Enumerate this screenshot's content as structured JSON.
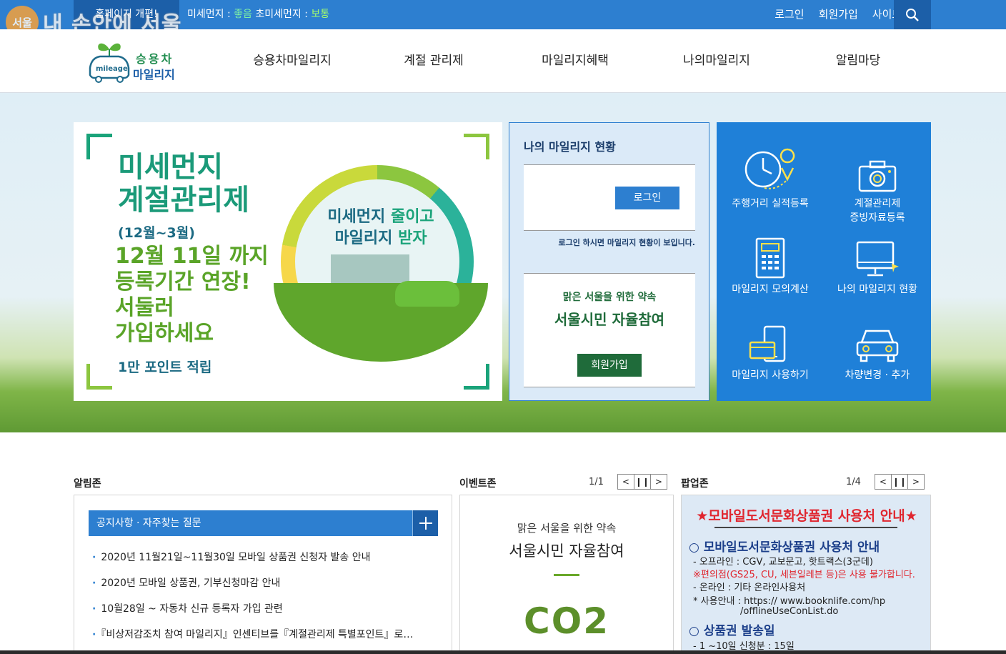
{
  "topbar": {
    "notice": "홈페이지 개편!",
    "dust_label": "미세먼지 :",
    "dust_value": "좋음",
    "fine_dust_label": "초미세먼지 :",
    "fine_dust_value": "보통",
    "links": [
      "로그인",
      "회원가입",
      "사이트맵"
    ],
    "search_icon": "search-icon"
  },
  "watermark": {
    "badge": "서울",
    "text": "내 손안에 서울"
  },
  "logo": {
    "line1": "승용차",
    "line2": "마일리지",
    "mark": "mileage"
  },
  "nav": [
    "승용차마일리지",
    "계절 관리제",
    "마일리지혜택",
    "나의마일리지",
    "알림마당"
  ],
  "banner": {
    "title_line1": "미세먼지",
    "title_line2": "계절관리제",
    "period": "(12월~3월)",
    "msg_line1": "12월 11일 까지",
    "msg_line2": "등록기간 연장!",
    "msg_line3": "서둘러",
    "msg_line4": "가입하세요",
    "points": "1만 포인트 적립",
    "slogan_line1_a": "미세먼지",
    "slogan_line1_b": "줄이고",
    "slogan_line2_a": "마일리지",
    "slogan_line2_b": "받자"
  },
  "my_status": {
    "title": "나의 마일리지 현황",
    "login_button": "로그인",
    "note": "로그인 하시면 마일리지 현황이 보입니다.",
    "promise": "맑은 서울을 위한 약속",
    "citizen": "서울시민 자율참여",
    "join_button": "회원가입"
  },
  "quick_menu": [
    {
      "icon": "clock-location-icon",
      "label": "주행거리 실적등록"
    },
    {
      "icon": "camera-icon",
      "label": "계절관리제\n증빙자료등록"
    },
    {
      "icon": "calculator-icon",
      "label": "마일리지 모의계산"
    },
    {
      "icon": "monitor-icon",
      "label": "나의 마일리지 현황"
    },
    {
      "icon": "phone-card-icon",
      "label": "마일리지 사용하기"
    },
    {
      "icon": "car-icon",
      "label": "차량변경 · 추가"
    }
  ],
  "alarm_zone": {
    "title": "알림존",
    "tab_label": "공지사항 · 자주찾는 질문",
    "items": [
      "2020년 11월21일~11월30일 모바일 상품권 신청자 발송 안내",
      "2020년 모바일 상품권, 기부신청마감 안내",
      "10월28일 ~ 자동차 신규 등록자 가입 관련",
      "『비상저감조치 참여 마일리지』인센티브를『계절관리제 특별포인트』로…"
    ]
  },
  "event_zone": {
    "title": "이벤트존",
    "count": "1/1",
    "line1": "맑은 서울을 위한 약속",
    "line2": "서울시민 자율참여",
    "co2": "CO2"
  },
  "popup_zone": {
    "title": "팝업존",
    "count": "1/4",
    "heading": "★모바일도서문화상품권 사용처 안내★",
    "sub1": "○ 모바일도서문화상품권 사용처 안내",
    "line1": "- 오프라인 : CGV, 교보문고, 핫트랙스(3군데)",
    "line2": "※편의점(GS25, CU, 세븐일레븐 등)은 사용 불가합니다.",
    "line3": "- 온라인 : 기타 온라인사용처",
    "line4": "* 사용안내 : https:// www.booknlife.com/hp",
    "line5": "/offlineUseConList.do",
    "sub2": "○ 상품권 발송일",
    "line6": "- 1 ~10일 신청분 : 15일"
  },
  "colors": {
    "primary_blue": "#2d7fd0",
    "dark_blue": "#1c5fa8",
    "green": "#1f6b3a",
    "red": "#e0262f"
  }
}
